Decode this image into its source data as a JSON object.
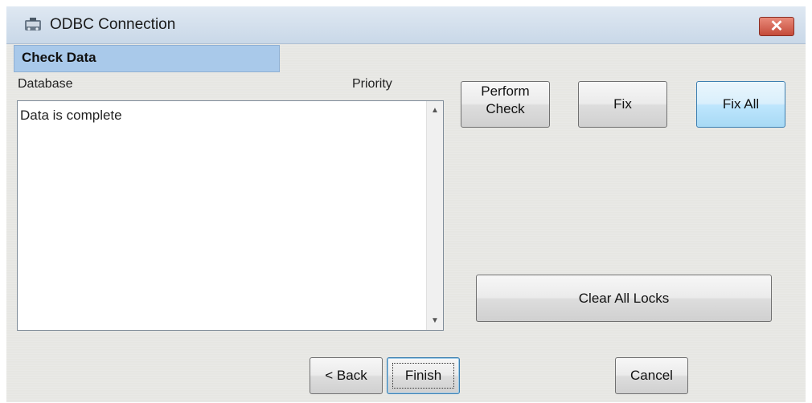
{
  "window": {
    "title": "ODBC Connection",
    "close_symbol": "✕"
  },
  "section": {
    "title": "Check Data"
  },
  "list": {
    "columns": [
      "Database",
      "Priority"
    ],
    "items": [
      "Data is complete"
    ]
  },
  "buttons": {
    "perform_check_line1": "Perform",
    "perform_check_line2": "Check",
    "fix": "Fix",
    "fix_all": "Fix All",
    "clear_all_locks": "Clear All Locks",
    "back": "< Back",
    "finish": "Finish",
    "cancel": "Cancel"
  },
  "colors": {
    "titlebar": "#c9d8e8",
    "section_header": "#a9c9ea",
    "close_button": "#c44b3a",
    "highlight_button": "#bee6fd"
  },
  "icons": [
    "app-icon",
    "close-icon",
    "scroll-up-icon",
    "scroll-down-icon"
  ]
}
